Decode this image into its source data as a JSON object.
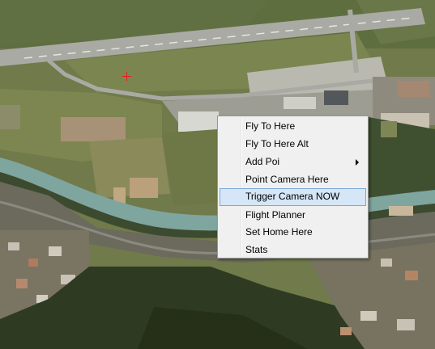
{
  "menu": {
    "items": [
      {
        "label": "Fly To Here"
      },
      {
        "label": "Fly To Here Alt"
      },
      {
        "label": "Add Poi",
        "submenu": true
      },
      {
        "label": "Point Camera Here"
      },
      {
        "label": "Trigger Camera NOW",
        "highlighted": true
      },
      {
        "label": "Flight Planner"
      },
      {
        "label": "Set Home Here"
      },
      {
        "label": "Stats"
      }
    ]
  },
  "colors": {
    "menu_bg": "#f0f0f0",
    "highlight_bg": "#d5e6f7",
    "highlight_border": "#7aa7d6",
    "target_marker": "#e02020"
  }
}
